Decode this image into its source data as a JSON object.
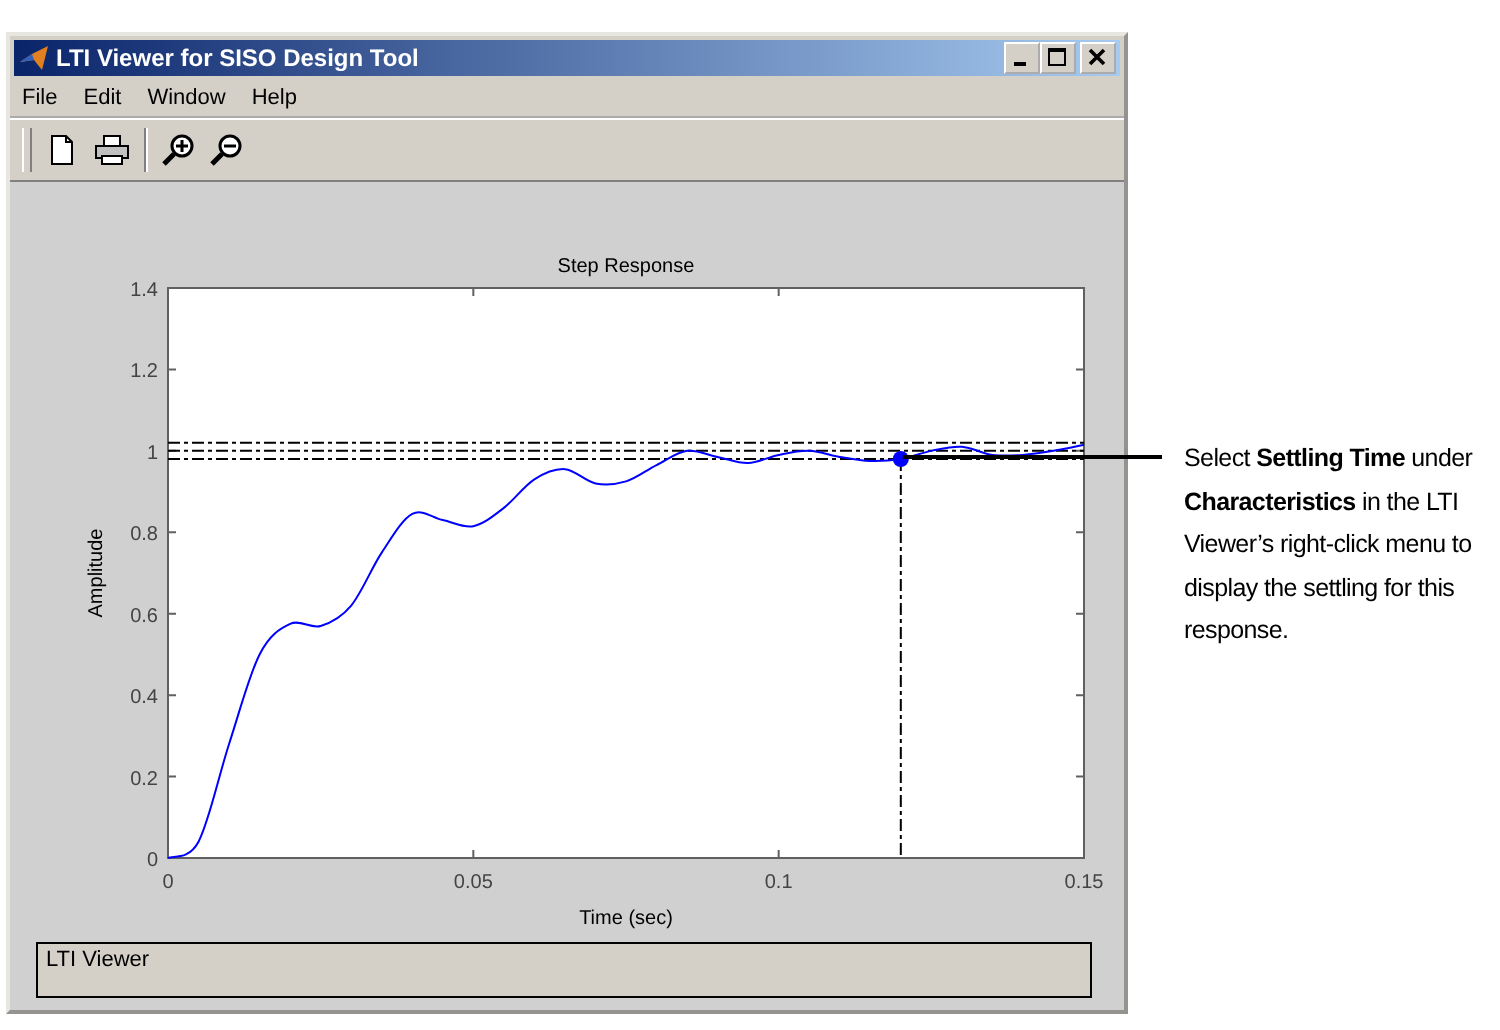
{
  "window": {
    "title": "LTI Viewer for SISO Design Tool"
  },
  "menu": [
    "File",
    "Edit",
    "Window",
    "Help"
  ],
  "plot": {
    "chart_data": {
      "type": "line",
      "title": "Step Response",
      "xlabel": "Time (sec)",
      "ylabel": "Amplitude",
      "x": [
        0,
        0.005,
        0.01,
        0.015,
        0.02,
        0.025,
        0.03,
        0.035,
        0.04,
        0.045,
        0.05,
        0.055,
        0.06,
        0.065,
        0.07,
        0.075,
        0.08,
        0.085,
        0.09,
        0.095,
        0.1,
        0.105,
        0.11,
        0.115,
        0.12,
        0.125,
        0.13,
        0.135,
        0.14,
        0.145,
        0.15
      ],
      "series": [
        {
          "color": "#0000ff",
          "values": [
            0,
            0.04,
            0.28,
            0.5,
            0.575,
            0.57,
            0.62,
            0.75,
            0.845,
            0.83,
            0.815,
            0.86,
            0.93,
            0.955,
            0.92,
            0.925,
            0.965,
            1.0,
            0.985,
            0.97,
            0.99,
            1.0,
            0.985,
            0.975,
            0.98,
            1.0,
            1.01,
            0.99,
            0.99,
            1.0,
            1.015
          ]
        }
      ],
      "xlim": [
        0,
        0.15
      ],
      "ylim": [
        0,
        1.4
      ],
      "xticks": [
        0,
        0.05,
        0.1,
        0.15
      ],
      "yticks": [
        0,
        0.2,
        0.4,
        0.6,
        0.8,
        1,
        1.2,
        1.4
      ],
      "ref_lines": [
        {
          "axis": "x",
          "value": 0.12
        }
      ]
    }
  },
  "status_bar": {
    "text": "LTI Viewer"
  },
  "callout": {
    "text": "Select **Settling Time** under **Characteristics** in the LTI Viewer’s right-click menu to display the settling for this response."
  }
}
